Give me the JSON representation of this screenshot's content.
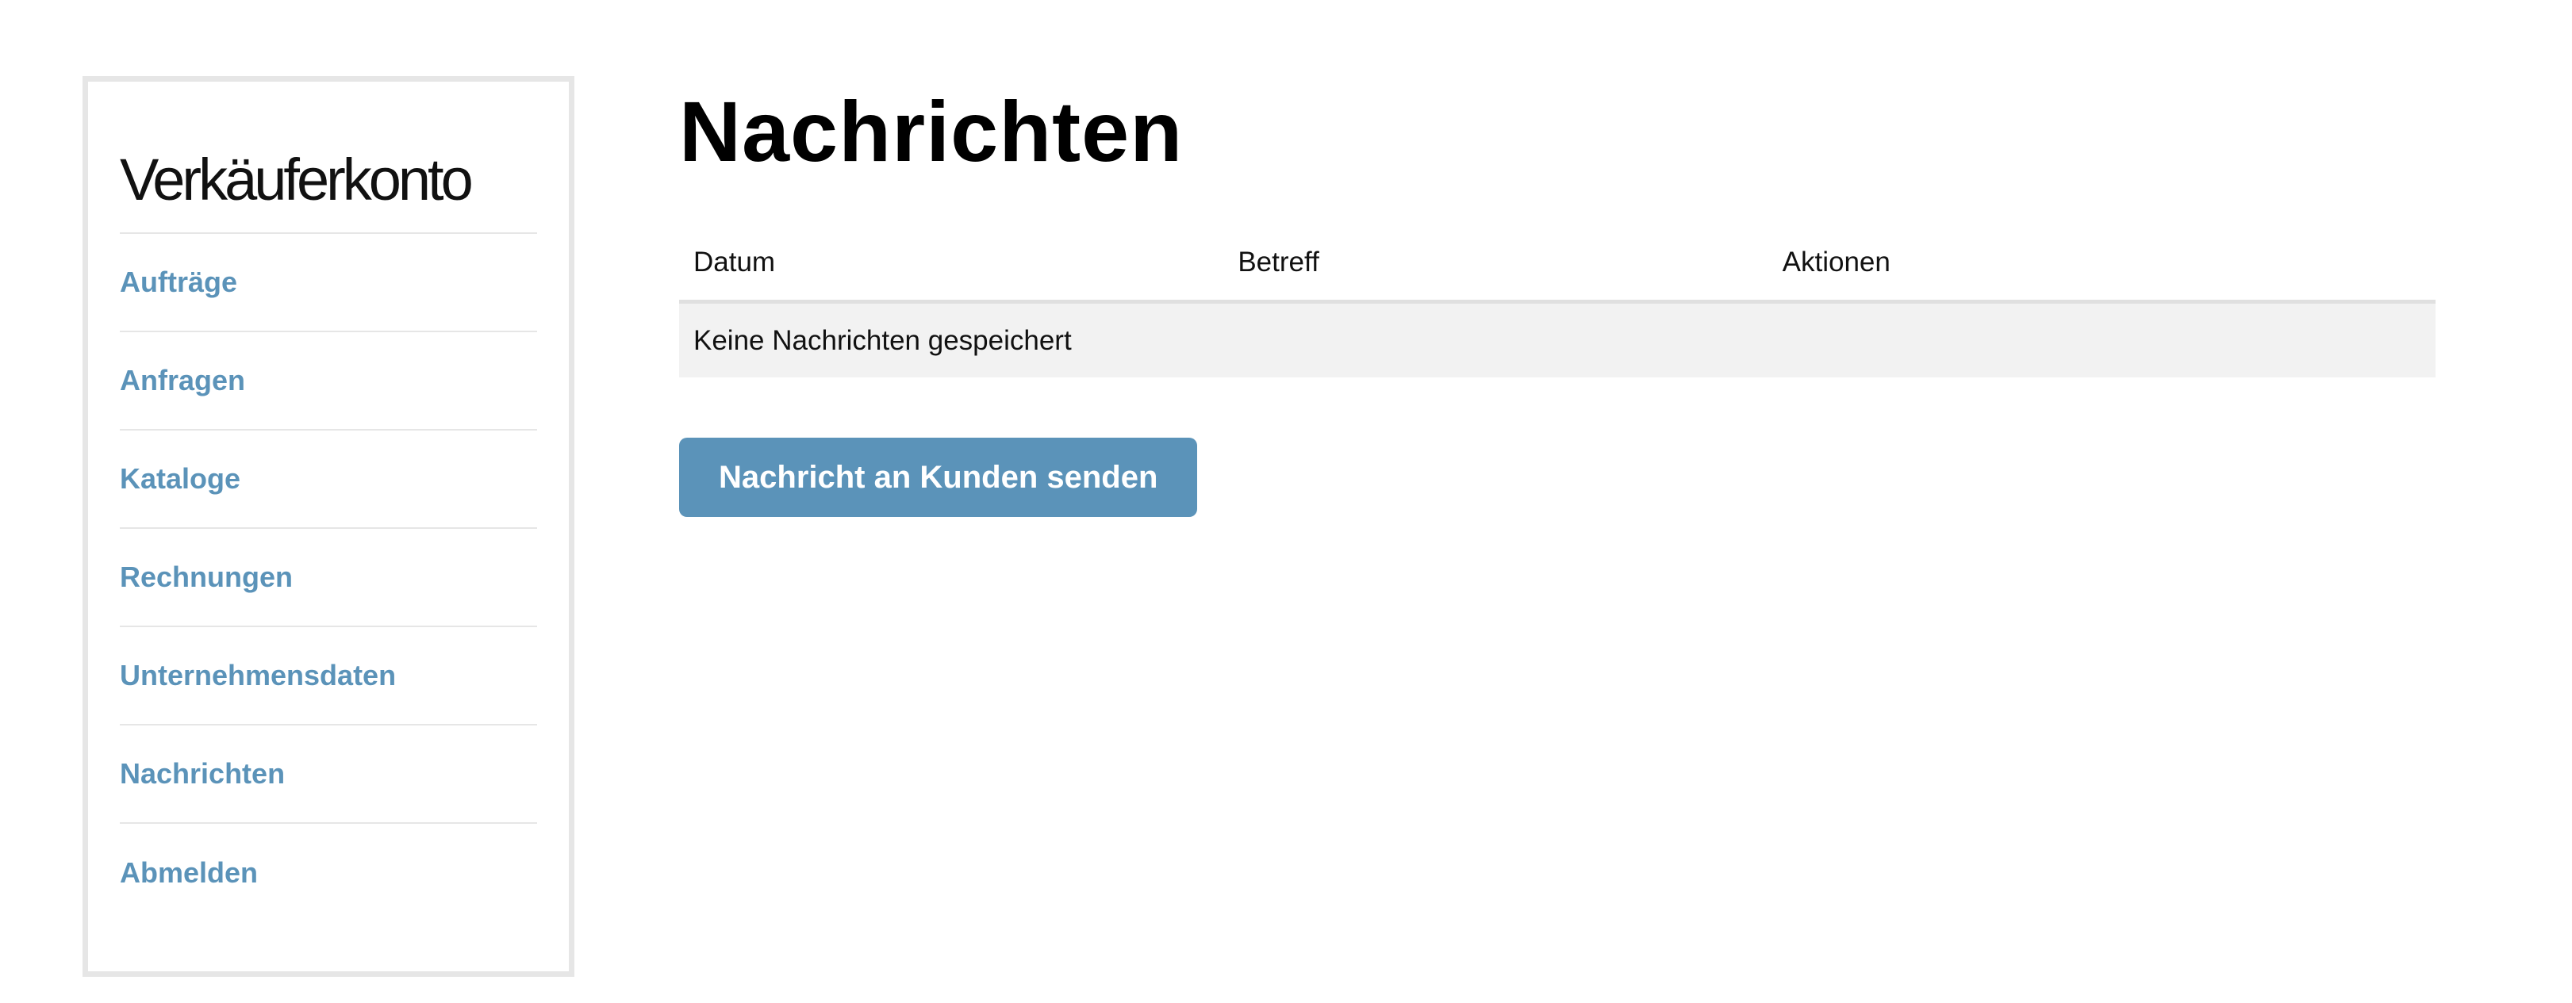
{
  "sidebar": {
    "title": "Verkäuferkonto",
    "items": [
      {
        "label": "Aufträge"
      },
      {
        "label": "Anfragen"
      },
      {
        "label": "Kataloge"
      },
      {
        "label": "Rechnungen"
      },
      {
        "label": "Unternehmensdaten"
      },
      {
        "label": "Nachrichten"
      },
      {
        "label": "Abmelden"
      }
    ]
  },
  "main": {
    "title": "Nachrichten",
    "table": {
      "columns": [
        "Datum",
        "Betreff",
        "Aktionen"
      ],
      "empty_message": "Keine Nachrichten gespeichert"
    },
    "send_button_label": "Nachricht an Kunden senden"
  },
  "colors": {
    "accent": "#5b93b9",
    "border": "#e6e6e6",
    "row_background": "#f2f2f2"
  }
}
